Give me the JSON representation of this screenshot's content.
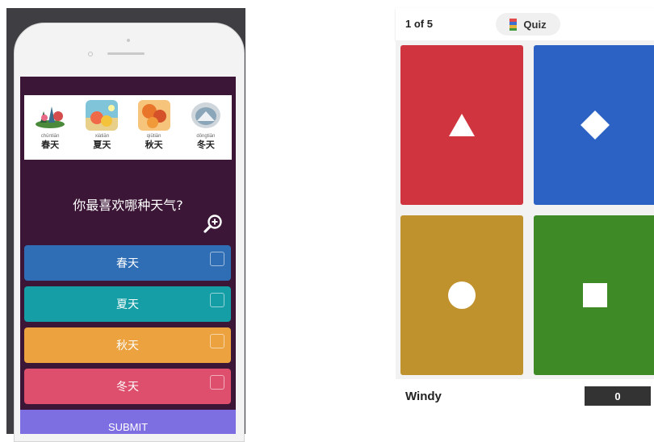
{
  "quiz_phone": {
    "question": "你最喜欢哪种天气?",
    "seasons": [
      {
        "pinyin": "chūntiān",
        "hanzi": "春天",
        "icon": "spring-icon"
      },
      {
        "pinyin": "xiàtiān",
        "hanzi": "夏天",
        "icon": "summer-icon"
      },
      {
        "pinyin": "qiūtiān",
        "hanzi": "秋天",
        "icon": "autumn-icon"
      },
      {
        "pinyin": "dōngtiān",
        "hanzi": "冬天",
        "icon": "winter-icon"
      }
    ],
    "answers": [
      {
        "label": "春天",
        "color": "#2f6eb5"
      },
      {
        "label": "夏天",
        "color": "#159ea5"
      },
      {
        "label": "秋天",
        "color": "#eba23f"
      },
      {
        "label": "冬天",
        "color": "#dd4f6c"
      }
    ],
    "submit_label": "SUBMIT",
    "colors": {
      "screen_bg": "#3b1637",
      "submit_bg": "#7d6ee2"
    }
  },
  "kahoot": {
    "counter": "1 of 5",
    "mode_label": "Quiz",
    "tiles": [
      {
        "shape": "triangle",
        "color": "#d0353f"
      },
      {
        "shape": "diamond",
        "color": "#2b62c4"
      },
      {
        "shape": "circle",
        "color": "#bf922d"
      },
      {
        "shape": "square",
        "color": "#3e8a26"
      }
    ],
    "player_name": "Windy",
    "score": "0"
  }
}
